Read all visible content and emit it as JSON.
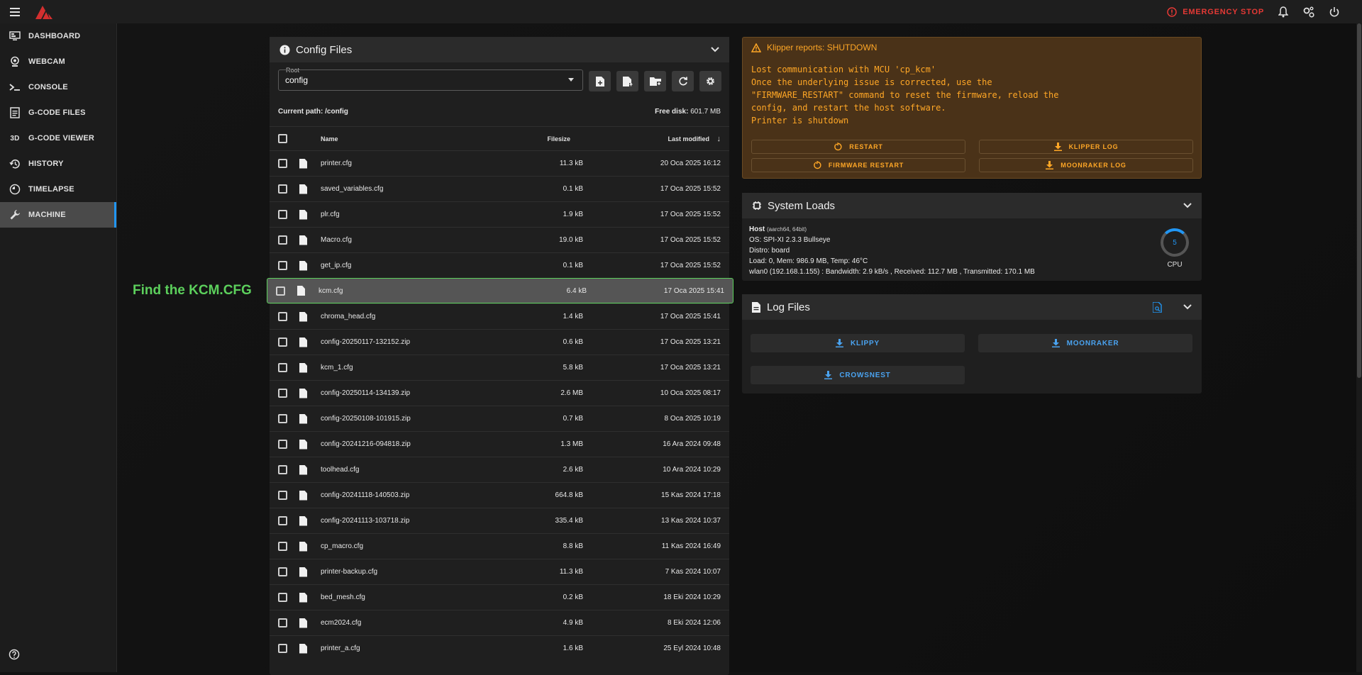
{
  "topbar": {
    "emergency_stop": "EMERGENCY STOP"
  },
  "sidebar": {
    "items": [
      {
        "label": "DASHBOARD",
        "icon": "monitor-dashboard-icon"
      },
      {
        "label": "WEBCAM",
        "icon": "webcam-icon"
      },
      {
        "label": "CONSOLE",
        "icon": "console-icon"
      },
      {
        "label": "G-CODE FILES",
        "icon": "file-document-icon"
      },
      {
        "label": "G-CODE VIEWER",
        "icon": "3d-icon"
      },
      {
        "label": "HISTORY",
        "icon": "history-icon"
      },
      {
        "label": "TIMELAPSE",
        "icon": "timelapse-icon"
      },
      {
        "label": "MACHINE",
        "icon": "wrench-icon",
        "active": true
      }
    ]
  },
  "annotation": "Find the KCM.CFG",
  "config": {
    "title": "Config Files",
    "root_label": "Root",
    "root_value": "config",
    "current_path_label": "Current path:",
    "current_path": "/config",
    "free_disk_label": "Free disk:",
    "free_disk": "601.7 MB",
    "columns": {
      "name": "Name",
      "size": "Filesize",
      "modified": "Last modified"
    },
    "files": [
      {
        "name": "printer.cfg",
        "size": "11.3 kB",
        "modified": "20 Oca 2025 16:12"
      },
      {
        "name": "saved_variables.cfg",
        "size": "0.1 kB",
        "modified": "17 Oca 2025 15:52"
      },
      {
        "name": "plr.cfg",
        "size": "1.9 kB",
        "modified": "17 Oca 2025 15:52"
      },
      {
        "name": "Macro.cfg",
        "size": "19.0 kB",
        "modified": "17 Oca 2025 15:52"
      },
      {
        "name": "get_ip.cfg",
        "size": "0.1 kB",
        "modified": "17 Oca 2025 15:52"
      },
      {
        "name": "kcm.cfg",
        "size": "6.4 kB",
        "modified": "17 Oca 2025 15:41",
        "selected": true
      },
      {
        "name": "chroma_head.cfg",
        "size": "1.4 kB",
        "modified": "17 Oca 2025 15:41"
      },
      {
        "name": "config-20250117-132152.zip",
        "size": "0.6 kB",
        "modified": "17 Oca 2025 13:21"
      },
      {
        "name": "kcm_1.cfg",
        "size": "5.8 kB",
        "modified": "17 Oca 2025 13:21"
      },
      {
        "name": "config-20250114-134139.zip",
        "size": "2.6 MB",
        "modified": "10 Oca 2025 08:17"
      },
      {
        "name": "config-20250108-101915.zip",
        "size": "0.7 kB",
        "modified": "8 Oca 2025 10:19"
      },
      {
        "name": "config-20241216-094818.zip",
        "size": "1.3 MB",
        "modified": "16 Ara 2024 09:48"
      },
      {
        "name": "toolhead.cfg",
        "size": "2.6 kB",
        "modified": "10 Ara 2024 10:29"
      },
      {
        "name": "config-20241118-140503.zip",
        "size": "664.8 kB",
        "modified": "15 Kas 2024 17:18"
      },
      {
        "name": "config-20241113-103718.zip",
        "size": "335.4 kB",
        "modified": "13 Kas 2024 10:37"
      },
      {
        "name": "cp_macro.cfg",
        "size": "8.8 kB",
        "modified": "11 Kas 2024 16:49"
      },
      {
        "name": "printer-backup.cfg",
        "size": "11.3 kB",
        "modified": "7 Kas 2024 10:07"
      },
      {
        "name": "bed_mesh.cfg",
        "size": "0.2 kB",
        "modified": "18 Eki 2024 10:29"
      },
      {
        "name": "ecm2024.cfg",
        "size": "4.9 kB",
        "modified": "8 Eki 2024 12:06"
      },
      {
        "name": "printer_a.cfg",
        "size": "1.6 kB",
        "modified": "25 Eyl 2024 10:48"
      }
    ]
  },
  "shutdown": {
    "title": "Klipper reports: SHUTDOWN",
    "message": "Lost communication with MCU 'cp_kcm'\nOnce the underlying issue is corrected, use the\n\"FIRMWARE_RESTART\" command to reset the firmware, reload the\nconfig, and restart the host software.\nPrinter is shutdown",
    "buttons": {
      "restart": "RESTART",
      "klipper_log": "KLIPPER LOG",
      "firmware_restart": "FIRMWARE RESTART",
      "moonraker_log": "MOONRAKER LOG"
    }
  },
  "system_loads": {
    "title": "System Loads",
    "host_label": "Host",
    "host_arch": "(aarch64, 64bit)",
    "os": "OS: SPI-XI 2.3.3 Bullseye",
    "distro": "Distro: board",
    "load": "Load: 0, Mem: 986.9 MB, Temp: 46°C",
    "network": "wlan0 (192.168.1.155) : Bandwidth: 2.9 kB/s , Received: 112.7 MB , Transmitted: 170.1 MB",
    "cpu_value": "5",
    "cpu_label": "CPU"
  },
  "log_files": {
    "title": "Log Files",
    "buttons": [
      "KLIPPY",
      "MOONRAKER",
      "CROWSNEST"
    ]
  }
}
